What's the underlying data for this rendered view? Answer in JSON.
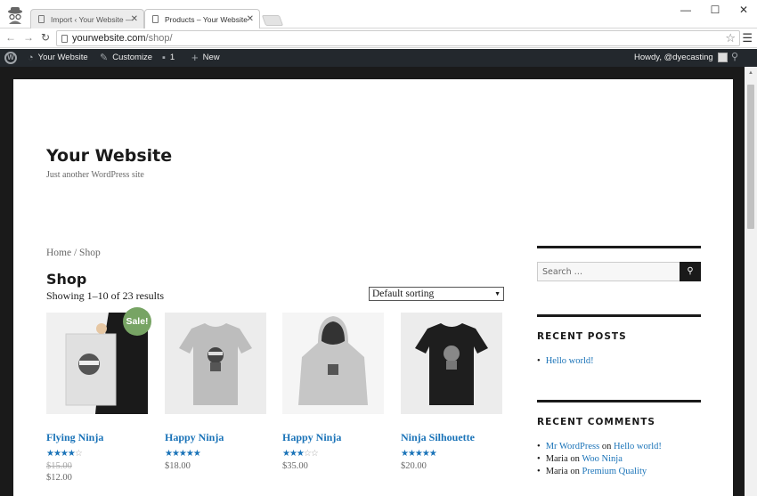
{
  "browser": {
    "tabs": [
      {
        "title": "Import ‹ Your Website —",
        "active": false
      },
      {
        "title": "Products – Your Website",
        "active": true
      }
    ],
    "url_host": "yourwebsite.com",
    "url_path": "/shop/",
    "window_controls": {
      "minimize": "—",
      "maximize": "☐",
      "close": "✕"
    }
  },
  "adminbar": {
    "site_name": "Your Website",
    "customize": "Customize",
    "comments_count": "1",
    "new_label": "New",
    "howdy": "Howdy, @dyecasting"
  },
  "site": {
    "title": "Your Website",
    "description": "Just another WordPress site"
  },
  "shop": {
    "breadcrumb": "Home / Shop",
    "title": "Shop",
    "result_count": "Showing 1–10 of 23 results",
    "sorting": "Default sorting",
    "sale_badge": "Sale!",
    "products": [
      {
        "name": "Flying Ninja",
        "rating": 4,
        "old_price": "$15.00",
        "price": "$12.00",
        "on_sale": true
      },
      {
        "name": "Happy Ninja",
        "rating": 5,
        "price": "$18.00"
      },
      {
        "name": "Happy Ninja",
        "rating": 3,
        "price": "$35.00"
      },
      {
        "name": "Ninja Silhouette",
        "rating": 5,
        "price": "$20.00"
      }
    ]
  },
  "sidebar": {
    "search_placeholder": "Search …",
    "recent_posts_title": "RECENT POSTS",
    "recent_posts": [
      "Hello world!"
    ],
    "recent_comments_title": "RECENT COMMENTS",
    "recent_comments": [
      {
        "author": "Mr WordPress",
        "on": "on",
        "post": "Hello world!"
      },
      {
        "author": "Maria",
        "on": "on",
        "post": "Woo Ninja"
      },
      {
        "author": "Maria",
        "on": "on",
        "post": "Premium Quality"
      }
    ]
  },
  "colors": {
    "link": "#1a73b8",
    "sale": "#77a464",
    "adminbar": "#23282d"
  }
}
